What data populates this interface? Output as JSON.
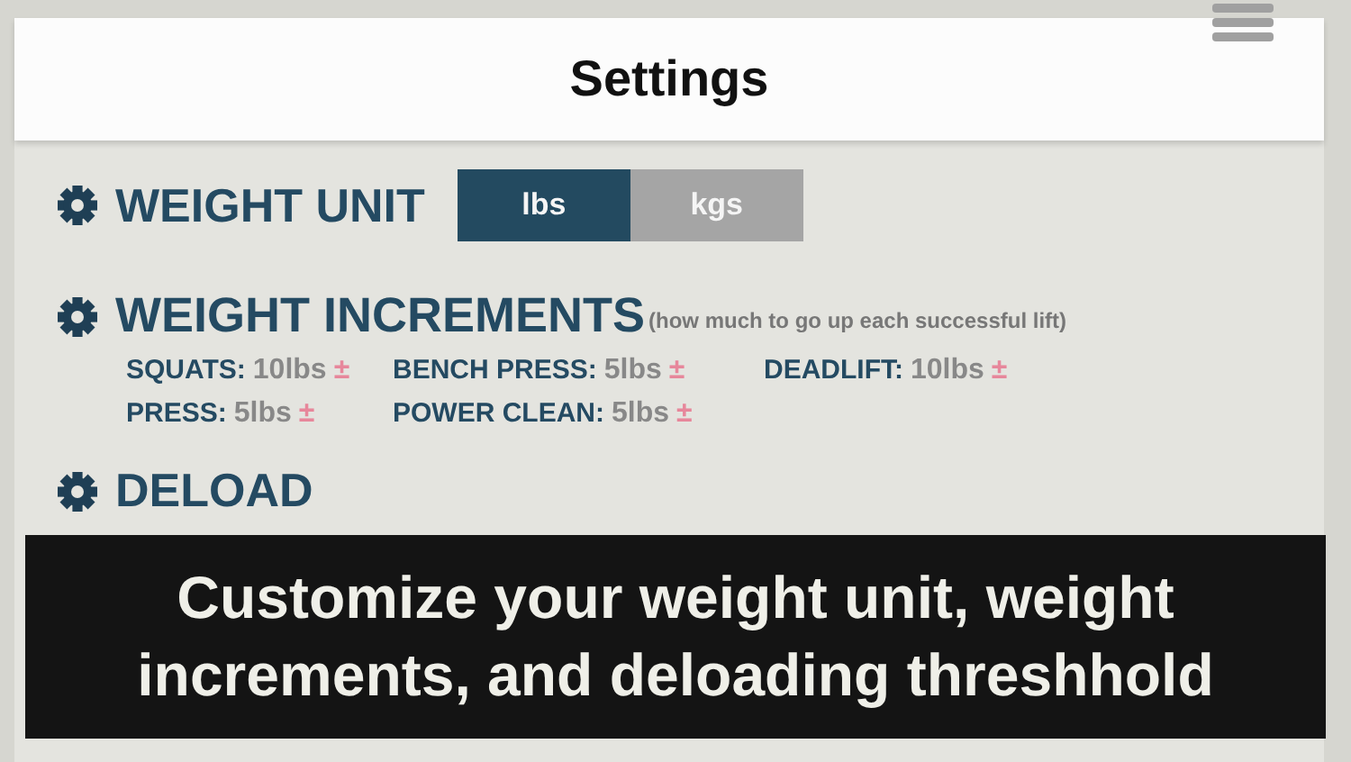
{
  "header": {
    "title": "Settings"
  },
  "sections": [
    {
      "kind": "unit",
      "title": "WEIGHT UNIT",
      "options": [
        {
          "label": "lbs",
          "selected": true
        },
        {
          "label": "kgs",
          "selected": false
        }
      ]
    },
    {
      "kind": "increments",
      "title": "WEIGHT INCREMENTS",
      "note": "(how much to go up each successful lift)",
      "lifts": [
        {
          "name": "SQUATS:",
          "value": "10lbs",
          "adjust": "±"
        },
        {
          "name": "BENCH PRESS:",
          "value": "5lbs",
          "adjust": "±"
        },
        {
          "name": "DEADLIFT:",
          "value": "10lbs",
          "adjust": "±"
        },
        {
          "name": "PRESS:",
          "value": "5lbs",
          "adjust": "±"
        },
        {
          "name": "POWER CLEAN:",
          "value": "5lbs",
          "adjust": "±"
        }
      ]
    },
    {
      "kind": "heading",
      "title": "DELOAD"
    }
  ],
  "caption": "Customize your weight unit, weight increments, and deloading threshhold"
}
